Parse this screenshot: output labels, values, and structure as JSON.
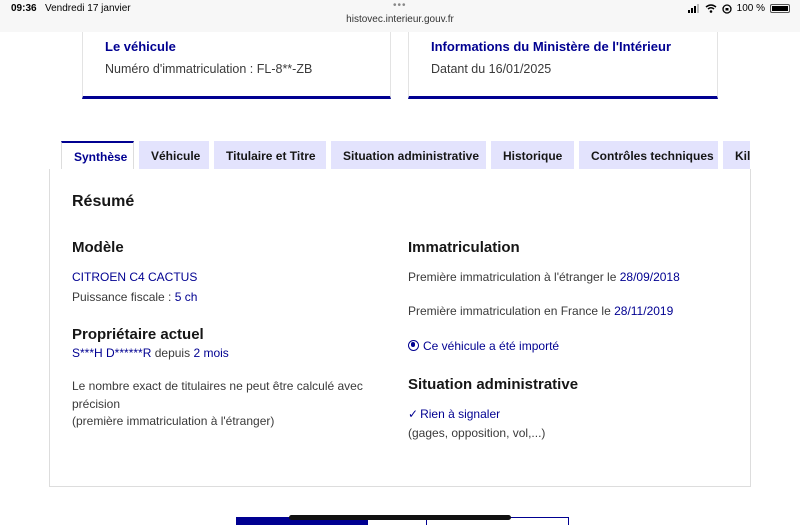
{
  "status_bar": {
    "time": "09:36",
    "date": "Vendredi 17 janvier",
    "dots": "•••",
    "url": "histovec.interieur.gouv.fr",
    "battery": "100 %"
  },
  "cards": {
    "vehicle": {
      "title": "Le véhicule",
      "text": "Numéro d'immatriculation : FL-8**-ZB"
    },
    "ministry": {
      "title": "Informations du Ministère de l'Intérieur",
      "text": "Datant du 16/01/2025"
    }
  },
  "tabs": [
    {
      "label": "Synthèse",
      "active": true
    },
    {
      "label": "Véhicule"
    },
    {
      "label": "Titulaire et Titre"
    },
    {
      "label": "Situation administrative"
    },
    {
      "label": "Historique"
    },
    {
      "label": "Contrôles techniques"
    },
    {
      "label": "Kilométrage"
    }
  ],
  "summary": {
    "heading": "Résumé",
    "model": {
      "heading": "Modèle",
      "name": "CITROEN C4 CACTUS",
      "power_label": "Puissance fiscale :",
      "power_value": "5 ch"
    },
    "owner": {
      "heading": "Propriétaire actuel",
      "name": "S***H D******R",
      "since_label": "depuis",
      "since_value": "2 mois",
      "note_line1": "Le nombre exact de titulaires ne peut être calculé avec",
      "note_line2": "précision",
      "note_line3": "(première immatriculation à l'étranger)"
    },
    "registration": {
      "heading": "Immatriculation",
      "foreign_label": "Première immatriculation à l'étranger le",
      "foreign_date": "28/09/2018",
      "france_label": "Première immatriculation en France le",
      "france_date": "28/11/2019",
      "imported": "Ce véhicule a été importé"
    },
    "admin": {
      "heading": "Situation administrative",
      "status": "Rien à signaler",
      "detail": "(gages, opposition, vol,...)"
    }
  },
  "colors": {
    "primary": "#000091",
    "tab_bg": "#e3e3fd"
  }
}
